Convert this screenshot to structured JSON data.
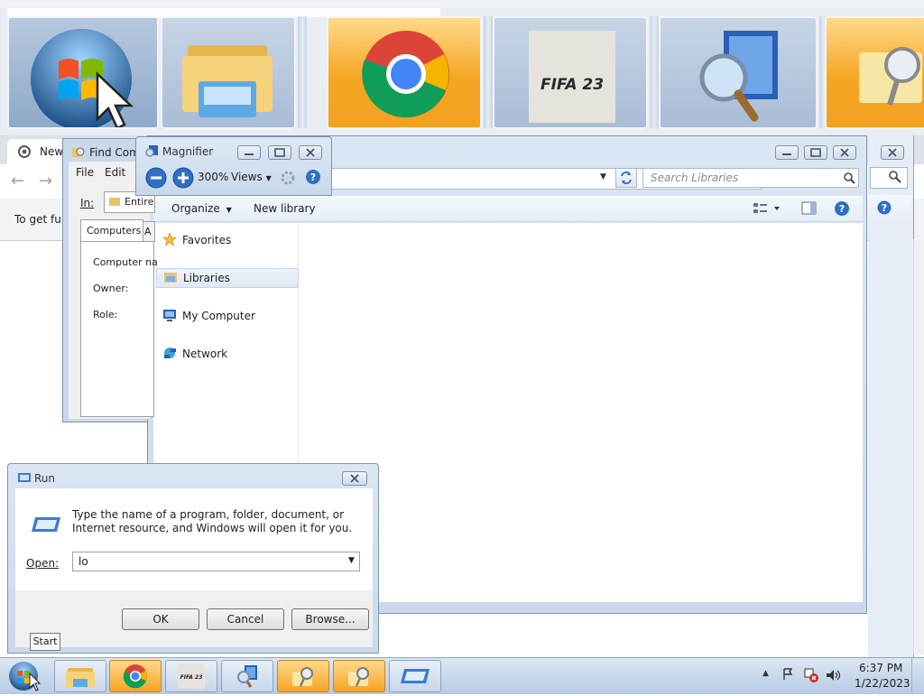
{
  "magnifier_lens": {
    "tiles": [
      "start-orb",
      "explorer",
      "chrome",
      "fifa23",
      "magnifier",
      "search"
    ],
    "fifa_label": "FIFA 23"
  },
  "chrome": {
    "tab_title": "New",
    "infobar_text": "To get fu"
  },
  "find_computers": {
    "title": "Find Com",
    "menu": [
      "File",
      "Edit"
    ],
    "in_label": "In:",
    "in_value": "Entire",
    "tab_computers": "Computers",
    "tab_other": "A",
    "computer_name_label": "Computer na",
    "owner_label": "Owner:",
    "role_label": "Role:"
  },
  "magnifier": {
    "title": "Magnifier",
    "zoom": "300%",
    "views_label": "Views"
  },
  "explorer": {
    "search_placeholder": "Search Libraries",
    "organize_label": "Organize",
    "new_library_label": "New library",
    "nav": {
      "favorites": "Favorites",
      "libraries": "Libraries",
      "my_computer": "My Computer",
      "network": "Network"
    }
  },
  "run": {
    "title": "Run",
    "description": "Type the name of a program, folder, document, or Internet resource, and Windows will open it for you.",
    "open_label": "Open:",
    "open_value": "lo",
    "ok_label": "OK",
    "cancel_label": "Cancel",
    "browse_label": "Browse..."
  },
  "tooltip": "Start",
  "taskbar": {
    "buttons": [
      "explorer",
      "chrome",
      "fifa23",
      "magnifier",
      "search",
      "search",
      "run"
    ],
    "fifa_label": "FIFA 23",
    "time": "6:37 PM",
    "date": "1/22/2023"
  }
}
